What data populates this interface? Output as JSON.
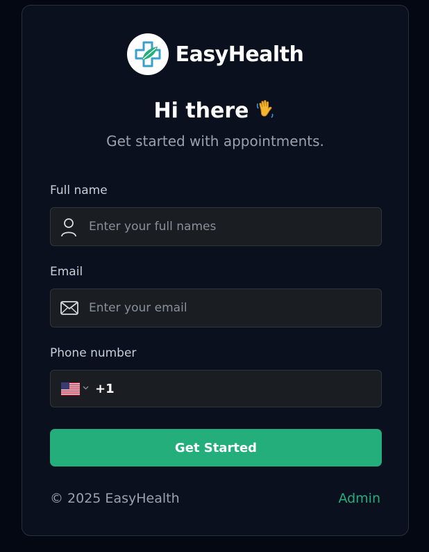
{
  "brand": {
    "name": "EasyHealth",
    "logo_icon": "medical-cross-icon",
    "colors": {
      "primary": "#24ae7c",
      "secondary": "#3aa0c9"
    }
  },
  "hero": {
    "title": "Hi there",
    "emoji_icon": "waving-hand-icon",
    "subtitle": "Get started with appointments."
  },
  "form": {
    "full_name": {
      "label": "Full name",
      "placeholder": "Enter your full names",
      "value": "",
      "icon": "user-icon"
    },
    "email": {
      "label": "Email",
      "placeholder": "Enter your email",
      "value": "",
      "icon": "mail-icon"
    },
    "phone": {
      "label": "Phone number",
      "country_flag": "us-flag-icon",
      "dial_code": "+1",
      "value": ""
    },
    "submit_label": "Get Started"
  },
  "footer": {
    "copyright": "© 2025 EasyHealth",
    "admin_link": "Admin"
  }
}
